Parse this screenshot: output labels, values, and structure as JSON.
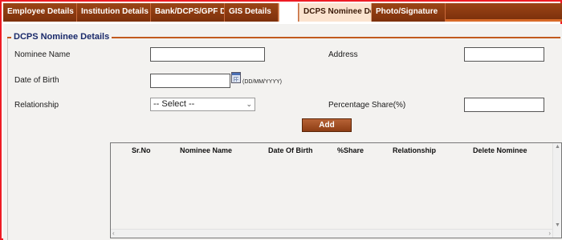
{
  "tabs": [
    {
      "label": "Employee Details"
    },
    {
      "label": "Institution Details"
    },
    {
      "label": "Bank/DCPS/GPF Details"
    },
    {
      "label": "GIS Details"
    },
    {
      "label": ""
    },
    {
      "label": "DCPS Nominee Details"
    },
    {
      "label": "Photo/Signature"
    }
  ],
  "section": {
    "title": "DCPS Nominee Details"
  },
  "form": {
    "nominee_name_label": "Nominee Name",
    "nominee_name_value": "",
    "address_label": "Address",
    "address_value": "",
    "dob_label": "Date of Birth",
    "dob_value": "",
    "dob_hint": "(DD/MM/YYYY)",
    "relationship_label": "Relationship",
    "relationship_selected": "-- Select --",
    "percentage_label": "Percentage Share(%)",
    "percentage_value": "",
    "add_label": "Add"
  },
  "grid": {
    "columns": [
      "Sr.No",
      "Nominee Name",
      "Date Of Birth",
      "%Share",
      "Relationship",
      "Delete Nominee"
    ],
    "rows": []
  },
  "icons": {
    "calendar": "calendar-icon",
    "dropdown": "chevron-down-icon"
  },
  "colors": {
    "tab_bar": "#8a3a12",
    "active_tab": "#fbe3cf",
    "accent_line": "#c25a1e",
    "frame_border": "#ee1c24",
    "section_title": "#1a2a6a"
  }
}
